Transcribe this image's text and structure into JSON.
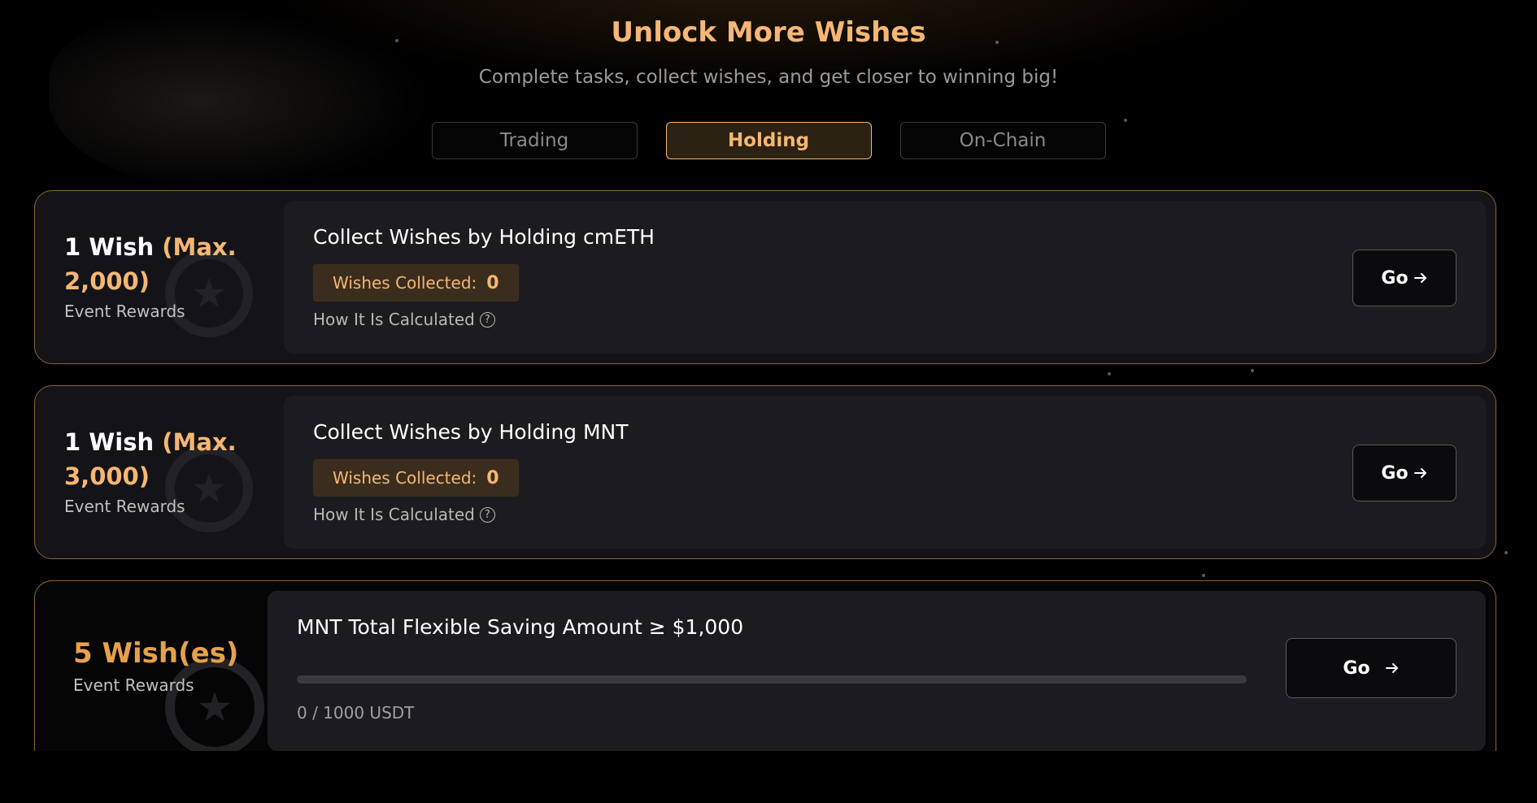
{
  "header": {
    "title": "Unlock More Wishes",
    "subtitle": "Complete tasks, collect wishes, and get closer to winning big!"
  },
  "tabs": [
    {
      "label": "Trading",
      "active": false
    },
    {
      "label": "Holding",
      "active": true
    },
    {
      "label": "On-Chain",
      "active": false
    }
  ],
  "tasks": [
    {
      "reward_prefix": "1 Wish ",
      "reward_gold": "(Max. 2,000)",
      "reward_label": "Event Rewards",
      "title": "Collect Wishes by Holding cmETH",
      "collected_label": "Wishes Collected:",
      "collected_value": "0",
      "how_label": "How It Is Calculated",
      "go_label": "Go"
    },
    {
      "reward_prefix": "1 Wish ",
      "reward_gold": "(Max. 3,000)",
      "reward_label": "Event Rewards",
      "title": "Collect Wishes by Holding MNT",
      "collected_label": "Wishes Collected:",
      "collected_value": "0",
      "how_label": "How It Is Calculated",
      "go_label": "Go"
    },
    {
      "reward_amount": "5 Wish(es)",
      "reward_label": "Event Rewards",
      "title": "MNT Total Flexible Saving Amount ≥ $1,000",
      "progress_value": 0,
      "progress_text": "0 / 1000 USDT",
      "go_label": "Go"
    }
  ],
  "icons": {
    "arrow": "arrow-right-icon",
    "question": "question-circle-icon",
    "badge": "star-badge-icon"
  },
  "colors": {
    "accent": "#f5b774",
    "reward_orange": "#e6a14a",
    "card_border": "#8a6435",
    "background": "#000000"
  }
}
